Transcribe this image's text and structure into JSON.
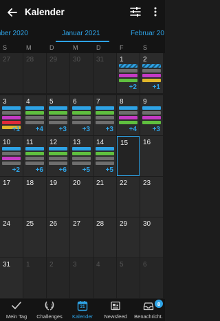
{
  "header": {
    "title": "Kalender"
  },
  "months": {
    "prev": "mber 2020",
    "current": "Januar 2021",
    "next": "Februar 20"
  },
  "weekdays": [
    "S",
    "M",
    "D",
    "M",
    "D",
    "F",
    "S"
  ],
  "colors": {
    "blue": "#2ea3e6",
    "green": "#5fbf3f",
    "magenta": "#c43ac4",
    "gray": "#6e6e6e",
    "yellow": "#e0b62a",
    "red": "#e02a3a"
  },
  "weeks": [
    [
      {
        "day": "27",
        "dim": true
      },
      {
        "day": "28",
        "dim": true
      },
      {
        "day": "29",
        "dim": true
      },
      {
        "day": "30",
        "dim": true
      },
      {
        "day": "31",
        "dim": true
      },
      {
        "day": "1",
        "bars": [
          "stripe",
          "gray",
          "magenta",
          "green"
        ],
        "more": "+2"
      },
      {
        "day": "2",
        "bars": [
          "stripe",
          "gray",
          "magenta",
          "yellow"
        ],
        "more": "+1"
      }
    ],
    [
      {
        "day": "3",
        "bars": [
          "blue",
          "gray",
          "magenta",
          "red",
          "yellow"
        ],
        "more": "+1"
      },
      {
        "day": "4",
        "bars": [
          "blue",
          "green",
          "gray",
          "gray"
        ],
        "more": "+4"
      },
      {
        "day": "5",
        "bars": [
          "blue",
          "green",
          "gray",
          "gray"
        ],
        "more": "+3"
      },
      {
        "day": "6",
        "bars": [
          "blue",
          "green",
          "gray",
          "gray"
        ],
        "more": "+3"
      },
      {
        "day": "7",
        "bars": [
          "blue",
          "green",
          "gray",
          "gray"
        ],
        "more": "+3"
      },
      {
        "day": "8",
        "bars": [
          "blue",
          "gray",
          "magenta",
          "green"
        ],
        "more": "+4"
      },
      {
        "day": "9",
        "bars": [
          "blue",
          "gray",
          "magenta",
          "green"
        ],
        "more": "+3"
      }
    ],
    [
      {
        "day": "10",
        "bars": [
          "blue",
          "gray",
          "magenta",
          "gray"
        ],
        "more": "+2"
      },
      {
        "day": "11",
        "bars": [
          "blue",
          "green",
          "gray",
          "gray"
        ],
        "more": "+6"
      },
      {
        "day": "12",
        "bars": [
          "blue",
          "green",
          "gray",
          "gray"
        ],
        "more": "+6"
      },
      {
        "day": "13",
        "bars": [
          "blue",
          "green",
          "gray",
          "gray"
        ],
        "more": "+5"
      },
      {
        "day": "14",
        "bars": [
          "blue",
          "green",
          "gray",
          "gray"
        ],
        "more": "+5"
      },
      {
        "day": "15",
        "today": true
      },
      {
        "day": "16"
      }
    ],
    [
      {
        "day": "17"
      },
      {
        "day": "18"
      },
      {
        "day": "19"
      },
      {
        "day": "20"
      },
      {
        "day": "21"
      },
      {
        "day": "22"
      },
      {
        "day": "23"
      }
    ],
    [
      {
        "day": "24"
      },
      {
        "day": "25"
      },
      {
        "day": "26"
      },
      {
        "day": "27"
      },
      {
        "day": "28"
      },
      {
        "day": "29"
      },
      {
        "day": "30"
      }
    ],
    [
      {
        "day": "31"
      },
      {
        "day": "1",
        "dim": true
      },
      {
        "day": "2",
        "dim": true
      },
      {
        "day": "3",
        "dim": true
      },
      {
        "day": "4",
        "dim": true
      },
      {
        "day": "5",
        "dim": true
      },
      {
        "day": "6",
        "dim": true
      }
    ]
  ],
  "nav": [
    {
      "label": "Mein Tag",
      "icon": "check-icon"
    },
    {
      "label": "Challenges",
      "icon": "laurel-icon"
    },
    {
      "label": "Kalender",
      "icon": "calendar-icon",
      "active": true,
      "calendar_day": "31"
    },
    {
      "label": "Newsfeed",
      "icon": "newspaper-icon"
    },
    {
      "label": "Benachricht.",
      "icon": "inbox-icon",
      "badge": "8"
    }
  ]
}
